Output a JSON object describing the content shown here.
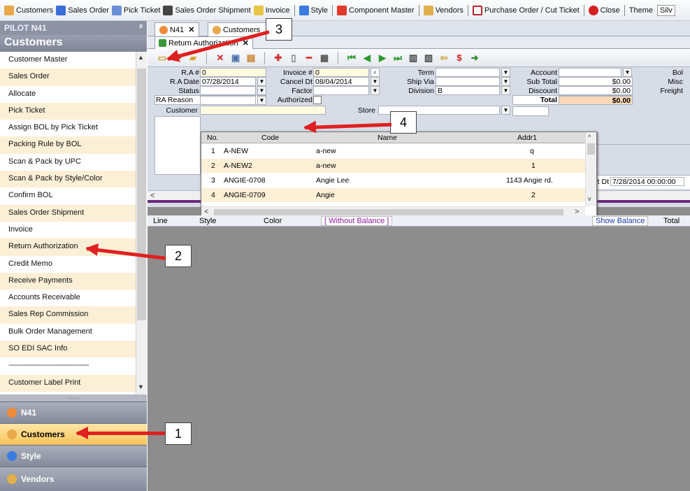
{
  "topbar": {
    "items": [
      "Customers",
      "Sales Order",
      "Pick Ticket",
      "Sales Order Shipment",
      "Invoice",
      "Style",
      "Component Master",
      "Vendors",
      "Purchase Order / Cut Ticket",
      "Close"
    ],
    "theme_label": "Theme",
    "theme_value": "Silv"
  },
  "sidebar": {
    "pilot": "PILOT N41",
    "pin": "ᵖ",
    "header": "Customers",
    "items": [
      "Customer Master",
      "Sales Order",
      "Allocate",
      "Pick Ticket",
      "Assign BOL by Pick Ticket",
      "Packing Rule by BOL",
      "Scan & Pack by UPC",
      "Scan & Pack by Style/Color",
      "Confirm BOL",
      "Sales Order Shipment",
      "Invoice",
      "Return Authorization",
      "Credit Memo",
      "Receive Payments",
      "Accounts Receivable",
      "Sales Rep Commission",
      "Bulk Order Management",
      "SO EDI SAC Info",
      "-------------------------------------------",
      "Customer Label Print"
    ],
    "grip": "........",
    "nav": [
      "N41",
      "Customers",
      "Style",
      "Vendors"
    ]
  },
  "tabs": {
    "t1": "N41",
    "t2": "Customers",
    "t3": "Return Authorization"
  },
  "form": {
    "ra_label": "R.A #",
    "ra_value": "0",
    "radate_label": "R.A Date",
    "radate_value": "07/28/2014",
    "status_label": "Status",
    "rareason_label": "RA Reason",
    "customer_label": "Customer",
    "invoice_label": "Invoice #",
    "invoice_value": "0",
    "canceldt_label": "Cancel Dt",
    "canceldt_value": "08/04/2014",
    "factor_label": "Factor",
    "authorized_label": "Authorized",
    "term_label": "Term",
    "shipvia_label": "Ship Via",
    "division_label": "Division",
    "division_value": "B",
    "store_label": "Store",
    "account_label": "Account",
    "subtotal_label": "Sub Total",
    "subtotal_value": "$0.00",
    "discount_label": "Discount",
    "discount_value": "$0.00",
    "total_label": "Total",
    "total_value": "$0.00",
    "bol_label": "Bol",
    "misc_label": "Misc",
    "freight_label": "Freight",
    "printdt_label": "t Dt",
    "printdt_value": "7/28/2014 00:00:00"
  },
  "popup": {
    "headers": [
      "No.",
      "Code",
      "Name",
      "Addr1"
    ],
    "rows": [
      {
        "no": "1",
        "code": "A-NEW",
        "name": "a-new",
        "addr": "q"
      },
      {
        "no": "2",
        "code": "A-NEW2",
        "name": "a-new",
        "addr": "1"
      },
      {
        "no": "3",
        "code": "ANGIE-0708",
        "name": "Angie Lee",
        "addr": "1143 Angie rd."
      },
      {
        "no": "4",
        "code": "ANGIE-0709",
        "name": "Angie",
        "addr": "2"
      }
    ]
  },
  "grid": {
    "cols": [
      "Line",
      "Style",
      "Color",
      "[ Without Balance ]",
      "Show Balance",
      "Total"
    ]
  },
  "callouts": [
    "1",
    "2",
    "3",
    "4"
  ],
  "colors": {
    "accent": "#e02020",
    "row_alt": "#fbefd6",
    "total_bg": "#f9d9b9"
  }
}
